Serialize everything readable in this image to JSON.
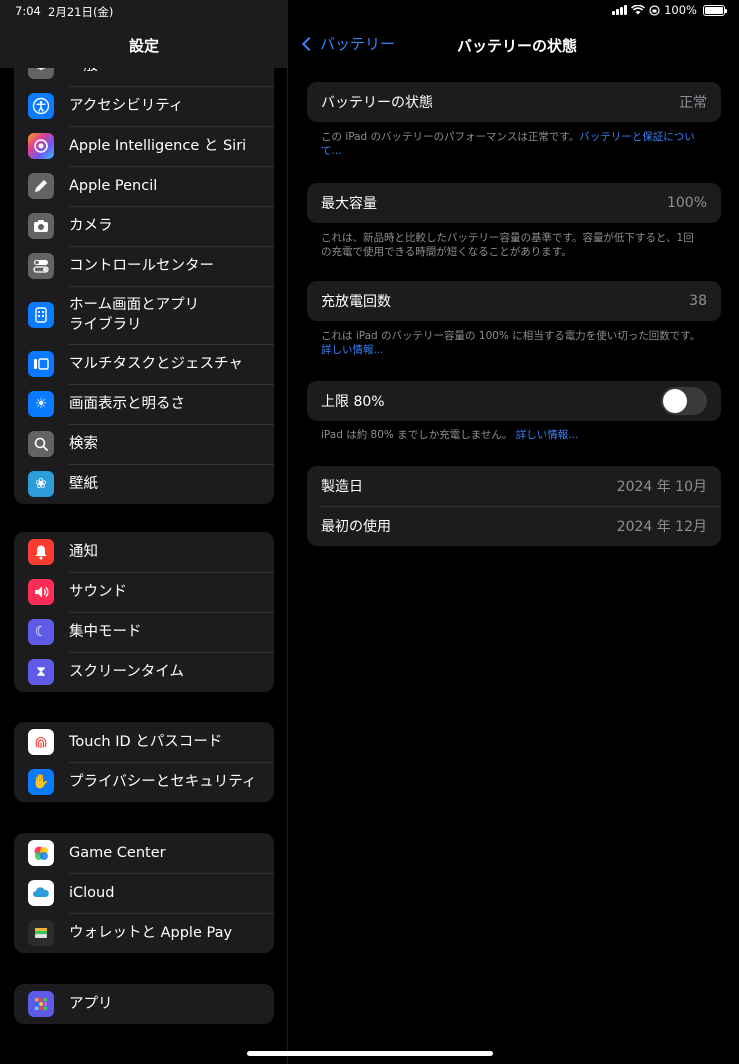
{
  "status_bar": {
    "time": "7:04",
    "date": "2月21日(金)",
    "battery": "100%"
  },
  "sidebar": {
    "title": "設定",
    "partial_item": "一般",
    "group1": [
      {
        "label": "アクセシビリティ",
        "icon": "accessibility-icon",
        "color": "#0a7aff"
      },
      {
        "label": "Apple Intelligence と Siri",
        "icon": "siri-icon",
        "color": "#c05ad6"
      },
      {
        "label": "Apple Pencil",
        "icon": "pencil-icon",
        "color": "#636366"
      },
      {
        "label": "カメラ",
        "icon": "camera-icon",
        "color": "#636366"
      },
      {
        "label": "コントロールセンター",
        "icon": "control-center-icon",
        "color": "#636366"
      },
      {
        "label": "ホーム画面とアプリライブラリ",
        "icon": "home-screen-icon",
        "color": "#0a7aff"
      },
      {
        "label": "マルチタスクとジェスチャ",
        "icon": "multitask-icon",
        "color": "#0a7aff"
      },
      {
        "label": "画面表示と明るさ",
        "icon": "brightness-icon",
        "color": "#0a7aff"
      },
      {
        "label": "検索",
        "icon": "search-icon",
        "color": "#636366"
      },
      {
        "label": "壁紙",
        "icon": "wallpaper-icon",
        "color": "#2d9cdb"
      }
    ],
    "group2": [
      {
        "label": "通知",
        "icon": "bell-icon",
        "color": "#ff3b30"
      },
      {
        "label": "サウンド",
        "icon": "speaker-icon",
        "color": "#ff2d55"
      },
      {
        "label": "集中モード",
        "icon": "moon-icon",
        "color": "#5e5ce6"
      },
      {
        "label": "スクリーンタイム",
        "icon": "hourglass-icon",
        "color": "#5e5ce6"
      }
    ],
    "group3": [
      {
        "label": "Touch ID とパスコード",
        "icon": "fingerprint-icon",
        "color": "#ffffff"
      },
      {
        "label": "プライバシーとセキュリティ",
        "icon": "hand-icon",
        "color": "#0a7aff"
      }
    ],
    "group4": [
      {
        "label": "Game Center",
        "icon": "game-center-icon",
        "color": "#ffffff"
      },
      {
        "label": "iCloud",
        "icon": "cloud-icon",
        "color": "#ffffff"
      },
      {
        "label": "ウォレットと Apple Pay",
        "icon": "wallet-icon",
        "color": "#2c2c2e"
      }
    ],
    "group5": [
      {
        "label": "アプリ",
        "icon": "apps-icon",
        "color": "#5e5ce6"
      }
    ]
  },
  "detail": {
    "back_label": "バッテリー",
    "title": "バッテリーの状態",
    "health": {
      "label": "バッテリーの状態",
      "value": "正常"
    },
    "health_note": "この iPad のバッテリーのパフォーマンスは正常です。",
    "health_note_link": "バッテリーと保証について...",
    "max_capacity": {
      "label": "最大容量",
      "value": "100%"
    },
    "capacity_note": "これは、新品時と比較したバッテリー容量の基準です。容量が低下すると、1回の充電で使用できる時間が短くなることがあります。",
    "cycle_count": {
      "label": "充放電回数",
      "value": "38"
    },
    "cycle_note": "これは iPad のバッテリー容量の 100% に相当する電力を使い切った回数です。",
    "cycle_note_link": "詳しい情報...",
    "limit": {
      "label": "上限 80%",
      "enabled": false
    },
    "limit_note": "iPad は約 80% までしか充電しません。",
    "limit_note_link": "詳しい情報...",
    "manufacture": {
      "label": "製造日",
      "value": "2024 年 10月"
    },
    "first_use": {
      "label": "最初の使用",
      "value": "2024 年 12月"
    }
  }
}
